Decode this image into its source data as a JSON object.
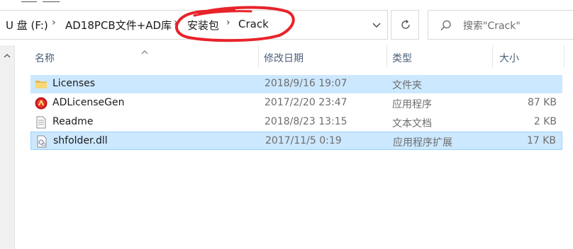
{
  "breadcrumb": {
    "items": [
      "U 盘 (F:)",
      "AD18PCB文件+AD库",
      "安装包",
      "Crack"
    ],
    "separator": ">"
  },
  "search": {
    "placeholder": "搜索\"Crack\""
  },
  "icons": {
    "dropdown": "chevron-down-icon",
    "refresh": "refresh-icon",
    "search": "search-icon",
    "sort": "sort-up-icon",
    "scroll_up": "scroll-up-icon"
  },
  "columns": {
    "name": "名称",
    "modified": "修改日期",
    "type": "类型",
    "size": "大小"
  },
  "files": [
    {
      "name": "Licenses",
      "modified": "2018/9/16 19:07",
      "type": "文件夹",
      "size": "",
      "icon": "folder-icon",
      "selected": true
    },
    {
      "name": "ADLicenseGen",
      "modified": "2017/2/20 23:47",
      "type": "应用程序",
      "size": "87 KB",
      "icon": "app-icon",
      "selected": false
    },
    {
      "name": "Readme",
      "modified": "2018/8/23 13:15",
      "type": "文本文档",
      "size": "2 KB",
      "icon": "text-file-icon",
      "selected": false
    },
    {
      "name": "shfolder.dll",
      "modified": "2017/11/5 0:19",
      "type": "应用程序扩展",
      "size": "17 KB",
      "icon": "dll-icon",
      "selected": true
    }
  ],
  "colors": {
    "selection": "#cce8ff",
    "selection_border": "#99d1ff",
    "annotation": "#e8232a",
    "header_text": "#4c607a"
  }
}
